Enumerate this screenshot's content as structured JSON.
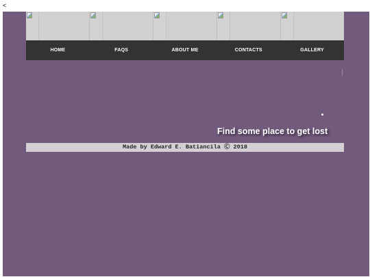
{
  "stray_text": "<",
  "banner": {
    "cells": [
      {
        "icon": "broken-image-icon"
      },
      {
        "icon": "broken-image-icon"
      },
      {
        "icon": "broken-image-icon"
      },
      {
        "icon": "broken-image-icon"
      },
      {
        "icon": "broken-image-icon"
      }
    ]
  },
  "nav": {
    "items": [
      {
        "label": "HOME"
      },
      {
        "label": "FAQS"
      },
      {
        "label": "ABOUT ME"
      },
      {
        "label": "CONTACTS"
      },
      {
        "label": "GALLERY"
      }
    ]
  },
  "hero": {
    "tagline": "Find some place to get lost"
  },
  "footer": {
    "text": "Made by Edward E. Batiancila Ⓒ 2018"
  },
  "colors": {
    "page_background": "#725a7d",
    "nav_background": "#333333",
    "banner_background": "#cfcfcf",
    "footer_background": "#d3cfd5",
    "tagline_color": "#ffffff"
  }
}
